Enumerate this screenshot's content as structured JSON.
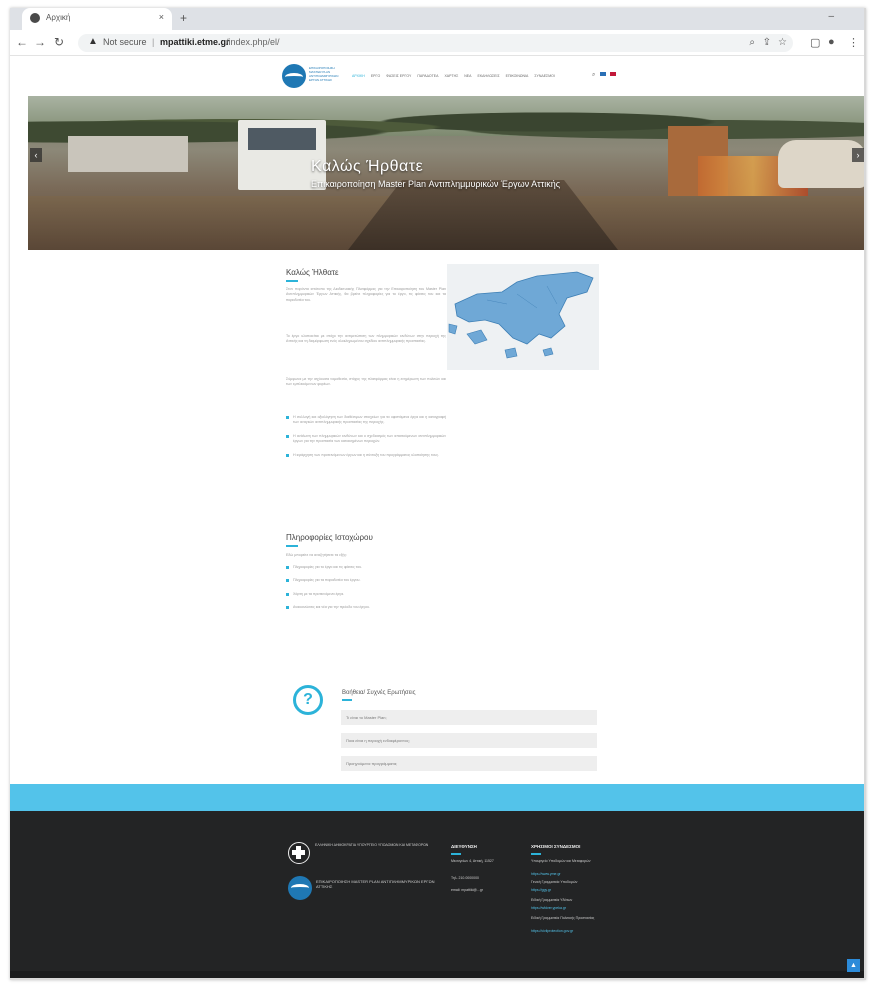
{
  "browser": {
    "tab_title": "Αρχική",
    "not_secure": "Not secure",
    "url_host": "mpattiki.etme.gr",
    "url_path": "/index.php/el/"
  },
  "site": {
    "logo_text": "ΕΠΙΚΑΙΡΟΠΟΙΗΣΗ MASTER PLAN ΑΝΤΙΠΛΗΜΜΥΡΙΚΩΝ ΕΡΓΩΝ ΑΤΤΙΚΗΣ",
    "menu": [
      "ΑΡΧΙΚΗ",
      "ΕΡΓΟ",
      "ΦΑΣΕΙΣ ΕΡΓΟΥ",
      "ΠΑΡΑΔΟΤΕΑ",
      "ΧΑΡΤΗΣ",
      "ΝΕΑ",
      "ΕΚΔΗΛΩΣΕΙΣ",
      "ΕΠΙΚΟΙΝΩΝΙΑ",
      "ΣΥΝΔΕΣΜΟΙ"
    ]
  },
  "hero": {
    "title": "Καλώς Ήρθατε",
    "subtitle": "Επικαιροποίηση Master Plan Αντιπλημμυρικών Έργων Αττικής",
    "prev": "‹",
    "next": "›"
  },
  "welcome": {
    "title": "Καλώς Ήλθατε",
    "p1": "Στον παρόντα ιστότοπο της Διαδικτυακής Πλατφόρμας για την Επικαιροποίηση του Master Plan Αντιπλημμυρικών Έργων Αττικής, θα βρείτε πληροφορίες για το έργο, τις φάσεις του και τα παραδοτέα του.",
    "p2": "Το έργο υλοποιείται με στόχο την αντιμετώπιση των πλημμυρικών κινδύνων στην περιοχή της Αττικής και τη διαμόρφωση ενός ολοκληρωμένου σχεδίου αντιπλημμυρικής προστασίας.",
    "p3": "Σύμφωνα με την ισχύουσα νομοθεσία, στόχος της πλατφόρμας είναι η ενημέρωση των πολιτών και των εμπλεκόμενων φορέων.",
    "bullets": [
      "Η συλλογή και αξιολόγηση των διαθέσιμων στοιχείων για τα υφιστάμενα έργα και η καταγραφή των αναγκών αντιπλημμυρικής προστασίας της περιοχής.",
      "Η ανάλυση των πλημμυρικών κινδύνων και ο σχεδιασμός των απαιτούμενων αντιπλημμυρικών έργων για την προστασία των κατοικημένων περιοχών.",
      "Η ιεράρχηση των προτεινόμενων έργων και η σύνταξη του προγράμματος υλοποίησης τους."
    ]
  },
  "info": {
    "title": "Πληροφορίες Ιστοχώρου",
    "intro": "Εδώ μπορείτε να αναζητήσετε τα εξής:",
    "bullets": [
      "Πληροφορίες για το έργο και τις φάσεις του.",
      "Πληροφορίες για τα παραδοτέα του έργου.",
      "Χάρτη με τα προτεινόμενα έργα.",
      "Ανακοινώσεις και νέα για την πρόοδο του έργου."
    ]
  },
  "faq": {
    "icon": "?",
    "title": "Βοήθεια/ Συχνές Ερωτήσεις",
    "items": [
      "Τι είναι το Master Plan;",
      "Ποια είναι η περιοχή ενδιαφέροντος;",
      "Προηγούμενα προγράμματα;"
    ]
  },
  "footer": {
    "ministry_text": "ΕΛΛΗΝΙΚΗ ΔΗΜΟΚΡΑΤΙΑ ΥΠΟΥΡΓΕΙΟ ΥΠΟΔΟΜΩΝ ΚΑΙ ΜΕΤΑΦΟΡΩΝ",
    "logo_text": "ΕΠΙΚΑΙΡΟΠΟΙΗΣΗ MASTER PLAN ΑΝΤΙΠΛΗΜΜΥΡΙΚΩΝ ΕΡΓΩΝ ΑΤΤΙΚΗΣ",
    "address_title": "ΔΙΕΥΘΥΝΣΗ",
    "address": "Μεσογείων 4, Αττική, 11527",
    "phone": "Τηλ. 210.0000000",
    "email": "email: mpattiki@...gr",
    "links_title": "ΧΡΗΣΙΜΟΙ ΣΥΝΔΕΣΜΟΙ",
    "links": [
      {
        "label": "Υπουργείο Υποδομών και Μεταφορών",
        "url": "https://www.yme.gr"
      },
      {
        "label": "Γενική Γραμματεία Υποδομών",
        "url": "https://ggy.gr"
      },
      {
        "label": "Ειδική Γραμματεία Υδάτων",
        "url": "https://wfdver.ypeka.gr"
      },
      {
        "label": "Ειδική Γραμματεία Πολιτικής Προστασίας",
        "url": "https://civilprotection.gov.gr"
      }
    ]
  },
  "colors": {
    "accent": "#2cb3d9",
    "footer_band": "#53c3ea",
    "footer_bg": "#232425"
  }
}
